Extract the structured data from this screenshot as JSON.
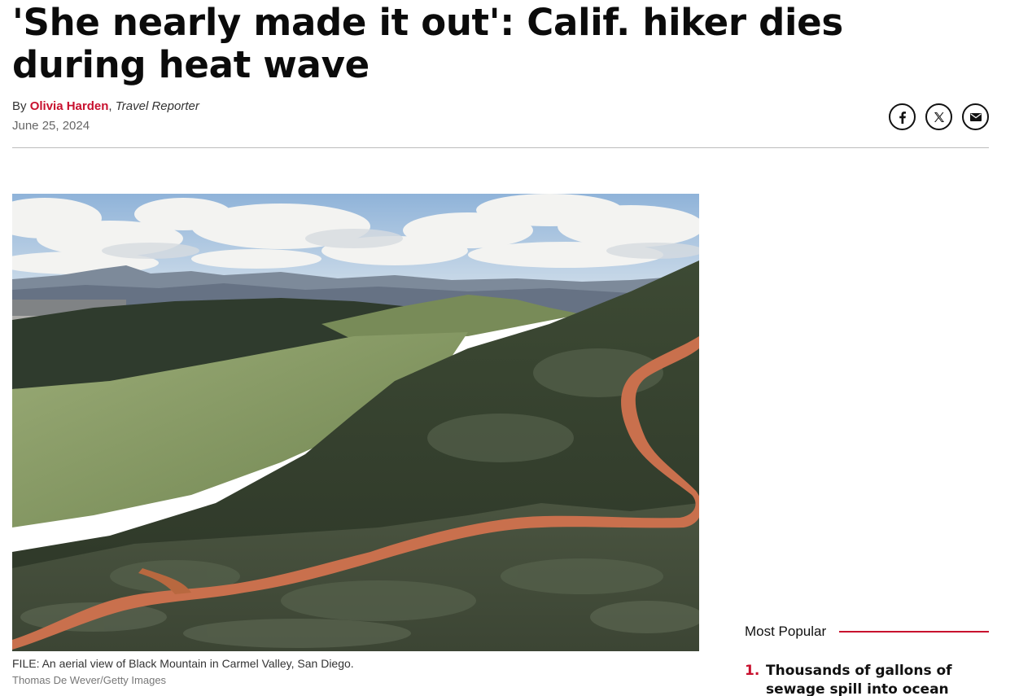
{
  "article": {
    "headline": "'She nearly made it out': Calif. hiker dies during heat wave",
    "byline_prefix": "By ",
    "author": "Olivia Harden",
    "separator": ", ",
    "author_role": "Travel Reporter",
    "date": "June 25, 2024"
  },
  "share": {
    "facebook_icon": "facebook-icon",
    "x_icon": "x-icon",
    "email_icon": "email-icon"
  },
  "hero": {
    "caption": "FILE: An aerial view of Black Mountain in Carmel Valley, San Diego.",
    "credit": "Thomas De Wever/Getty Images"
  },
  "most_popular": {
    "title": "Most Popular",
    "items": [
      {
        "number": "1.",
        "text": "Thousands of gallons of sewage spill into ocean at"
      }
    ]
  },
  "colors": {
    "accent": "#c8102e",
    "text": "#111111",
    "muted": "#666666"
  }
}
